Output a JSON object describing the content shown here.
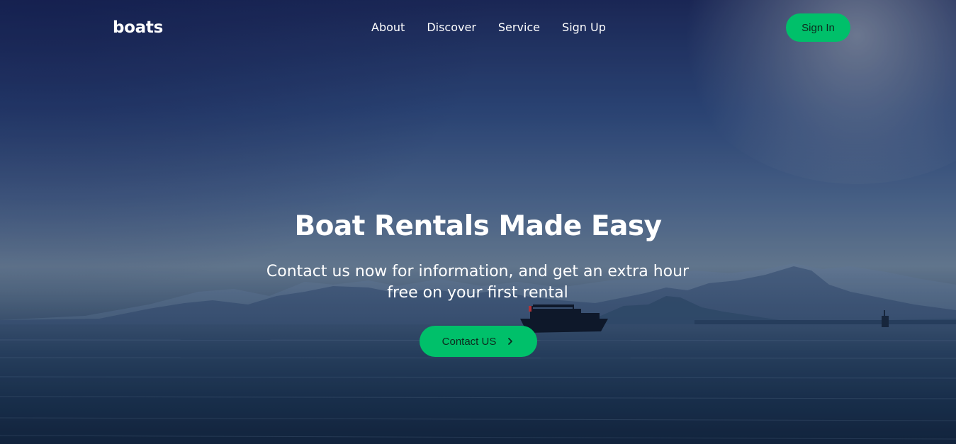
{
  "brand": {
    "name": "boats"
  },
  "nav": {
    "links": [
      "About",
      "Discover",
      "Service",
      "Sign Up"
    ],
    "signin_label": "Sign In"
  },
  "hero": {
    "headline": "Boat Rentals Made Easy",
    "subtext": "Contact us now for information, and get an extra hour free on your first rental",
    "cta_label": "Contact US",
    "cta_icon": "chevron-right-icon"
  },
  "colors": {
    "accent": "#00c06a",
    "button_text": "#0d2a1e",
    "text": "#ffffff"
  }
}
